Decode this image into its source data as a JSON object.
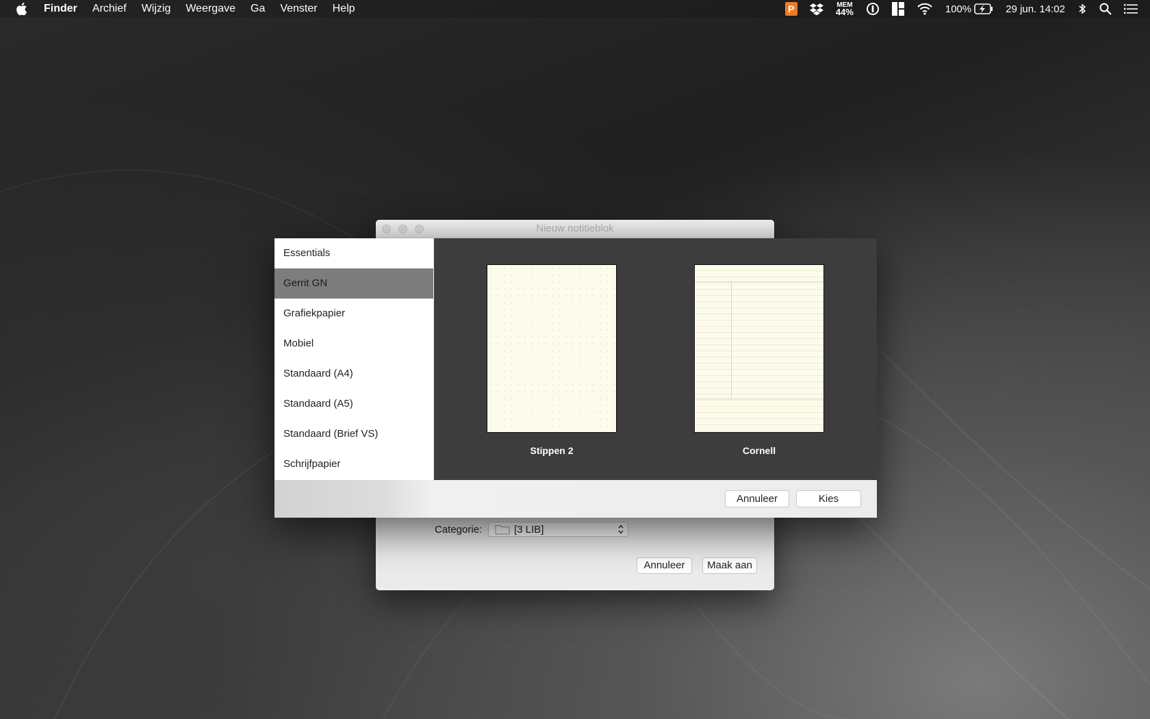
{
  "menubar": {
    "app_name": "Finder",
    "items": [
      "Archief",
      "Wijzig",
      "Weergave",
      "Ga",
      "Venster",
      "Help"
    ],
    "status": {
      "p_badge": "P",
      "mem_label": "MEM",
      "mem_value": "44%",
      "battery_text": "100%",
      "datetime": "29 jun.  14:02"
    }
  },
  "back_dialog": {
    "title": "Nieuw notitieblok",
    "category_label": "Categorie:",
    "category_value": "[3 LIB]",
    "cancel_label": "Annuleer",
    "create_label": "Maak aan"
  },
  "template_sheet": {
    "categories": [
      "Essentials",
      "Gerrit GN",
      "Grafiekpapier",
      "Mobiel",
      "Standaard (A4)",
      "Standaard (A5)",
      "Standaard (Brief VS)",
      "Schrijfpapier"
    ],
    "selected_category": "Gerrit GN",
    "templates": [
      {
        "name": "Stippen 2",
        "style": "dots"
      },
      {
        "name": "Cornell",
        "style": "cornell"
      }
    ],
    "cancel_label": "Annuleer",
    "choose_label": "Kies"
  },
  "colors": {
    "paper": "#fdfcec",
    "preview_bg": "#3d3d3d",
    "selected_row": "#7d7d7d",
    "p_badge": "#f07a27"
  }
}
